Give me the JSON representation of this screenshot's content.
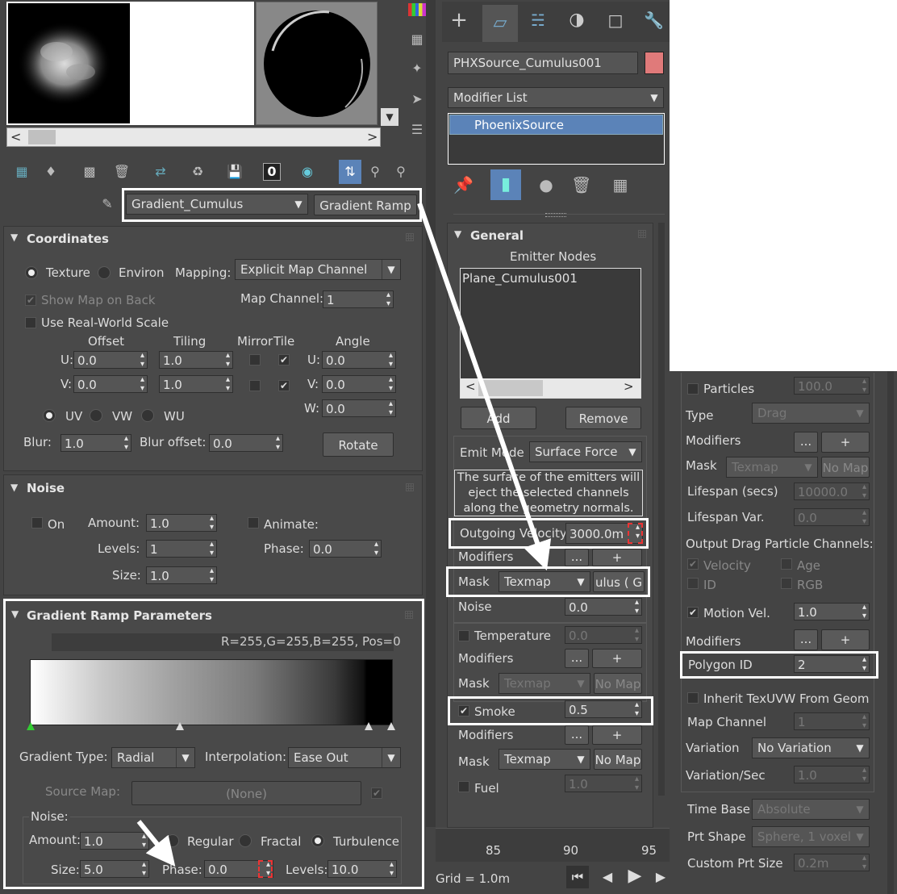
{
  "material_editor": {
    "slot_scroll_left": "<",
    "slot_scroll_right": ">",
    "map_name": "Gradient_Cumulus",
    "map_type_button": "Gradient Ramp",
    "coordinates": {
      "title": "Coordinates",
      "texture_label": "Texture",
      "environ_label": "Environ",
      "mapping_label": "Mapping:",
      "mapping_value": "Explicit Map Channel",
      "show_map_on_back": "Show Map on Back",
      "map_channel_label": "Map Channel:",
      "map_channel_value": "1",
      "use_real_world": "Use Real-World Scale",
      "offset_label": "Offset",
      "tiling_label": "Tiling",
      "mirror_label": "Mirror",
      "tile_label": "Tile",
      "angle_label": "Angle",
      "u_label": "U:",
      "v_label": "V:",
      "w_label": "W:",
      "u_offset": "0.0",
      "v_offset": "0.0",
      "u_tiling": "1.0",
      "v_tiling": "1.0",
      "u_angle": "0.0",
      "v_angle": "0.0",
      "w_angle": "0.0",
      "uv_label": "UV",
      "vw_label": "VW",
      "wu_label": "WU",
      "blur_label": "Blur:",
      "blur_value": "1.0",
      "blur_offset_label": "Blur offset:",
      "blur_offset_value": "0.0",
      "rotate_button": "Rotate"
    },
    "noise": {
      "title": "Noise",
      "on_label": "On",
      "amount_label": "Amount:",
      "amount_value": "1.0",
      "animate_label": "Animate:",
      "levels_label": "Levels:",
      "levels_value": "1",
      "phase_label": "Phase:",
      "phase_value": "0.0",
      "size_label": "Size:",
      "size_value": "1.0"
    },
    "gradient_ramp": {
      "title": "Gradient Ramp Parameters",
      "readout": "R=255,G=255,B=255, Pos=0",
      "gradient_type_label": "Gradient Type:",
      "gradient_type_value": "Radial",
      "interpolation_label": "Interpolation:",
      "interpolation_value": "Ease Out",
      "source_map_label": "Source Map:",
      "source_map_value": "(None)",
      "noise_label": "Noise:",
      "amount_label": "Amount:",
      "amount_value": "1.0",
      "regular_label": "Regular",
      "fractal_label": "Fractal",
      "turbulence_label": "Turbulence",
      "size_label": "Size:",
      "size_value": "5.0",
      "phase_label": "Phase:",
      "phase_value": "0.0",
      "levels_label": "Levels:",
      "levels_value": "10.0"
    }
  },
  "command_panel": {
    "object_name": "PHXSource_Cumulus001",
    "object_color": "#e07a7a",
    "modifier_list_label": "Modifier List",
    "stack_item": "PhoenixSource",
    "general": {
      "title": "General",
      "emitter_nodes_label": "Emitter Nodes",
      "emitter_node": "Plane_Cumulus001",
      "add_button": "Add",
      "remove_button": "Remove",
      "emit_mode_label": "Emit Mode",
      "emit_mode_value": "Surface Force",
      "description": "The surface of the emitters will eject the selected channels along the geometry normals.",
      "outgoing_velocity_label": "Outgoing Velocity",
      "outgoing_velocity_value": "3000.0m",
      "modifiers_label": "Modifiers",
      "ellipsis": "...",
      "plus": "+",
      "mask_label": "Mask",
      "texmap_value": "Texmap",
      "mask_map_value": "ulus  ( G",
      "noise_label": "Noise",
      "noise_value": "0.0",
      "temperature_label": "Temperature",
      "temperature_value": "0.0",
      "no_map": "No Map",
      "smoke_label": "Smoke",
      "smoke_value": "0.5",
      "fuel_label": "Fuel",
      "fuel_value": "1.0"
    },
    "timeline": {
      "ticks": [
        "85",
        "90",
        "95"
      ],
      "grid_label": "Grid = 1.0m"
    }
  },
  "particles_panel": {
    "particles_label": "Particles",
    "particles_value": "100.0",
    "type_label": "Type",
    "type_value": "Drag",
    "modifiers_label": "Modifiers",
    "ellipsis": "...",
    "plus": "+",
    "mask_label": "Mask",
    "texmap_value": "Texmap",
    "no_map": "No Map",
    "lifespan_label": "Lifespan (secs)",
    "lifespan_value": "10000.0",
    "lifespan_var_label": "Lifespan Var.",
    "lifespan_var_value": "0.0",
    "output_channels_label": "Output Drag Particle Channels:",
    "velocity_label": "Velocity",
    "age_label": "Age",
    "id_label": "ID",
    "rgb_label": "RGB",
    "motion_vel_label": "Motion Vel.",
    "motion_vel_value": "1.0",
    "polygon_id_label": "Polygon ID",
    "polygon_id_value": "2",
    "inherit_label": "Inherit TexUVW From Geom",
    "map_channel_label": "Map Channel",
    "map_channel_value": "1",
    "variation_label": "Variation",
    "variation_value": "No Variation",
    "variation_sec_label": "Variation/Sec",
    "variation_sec_value": "1.0",
    "time_base_label": "Time Base",
    "time_base_value": "Absolute",
    "prt_shape_label": "Prt Shape",
    "prt_shape_value": "Sphere, 1 voxel",
    "custom_prt_label": "Custom Prt Size",
    "custom_prt_value": "0.2m"
  }
}
